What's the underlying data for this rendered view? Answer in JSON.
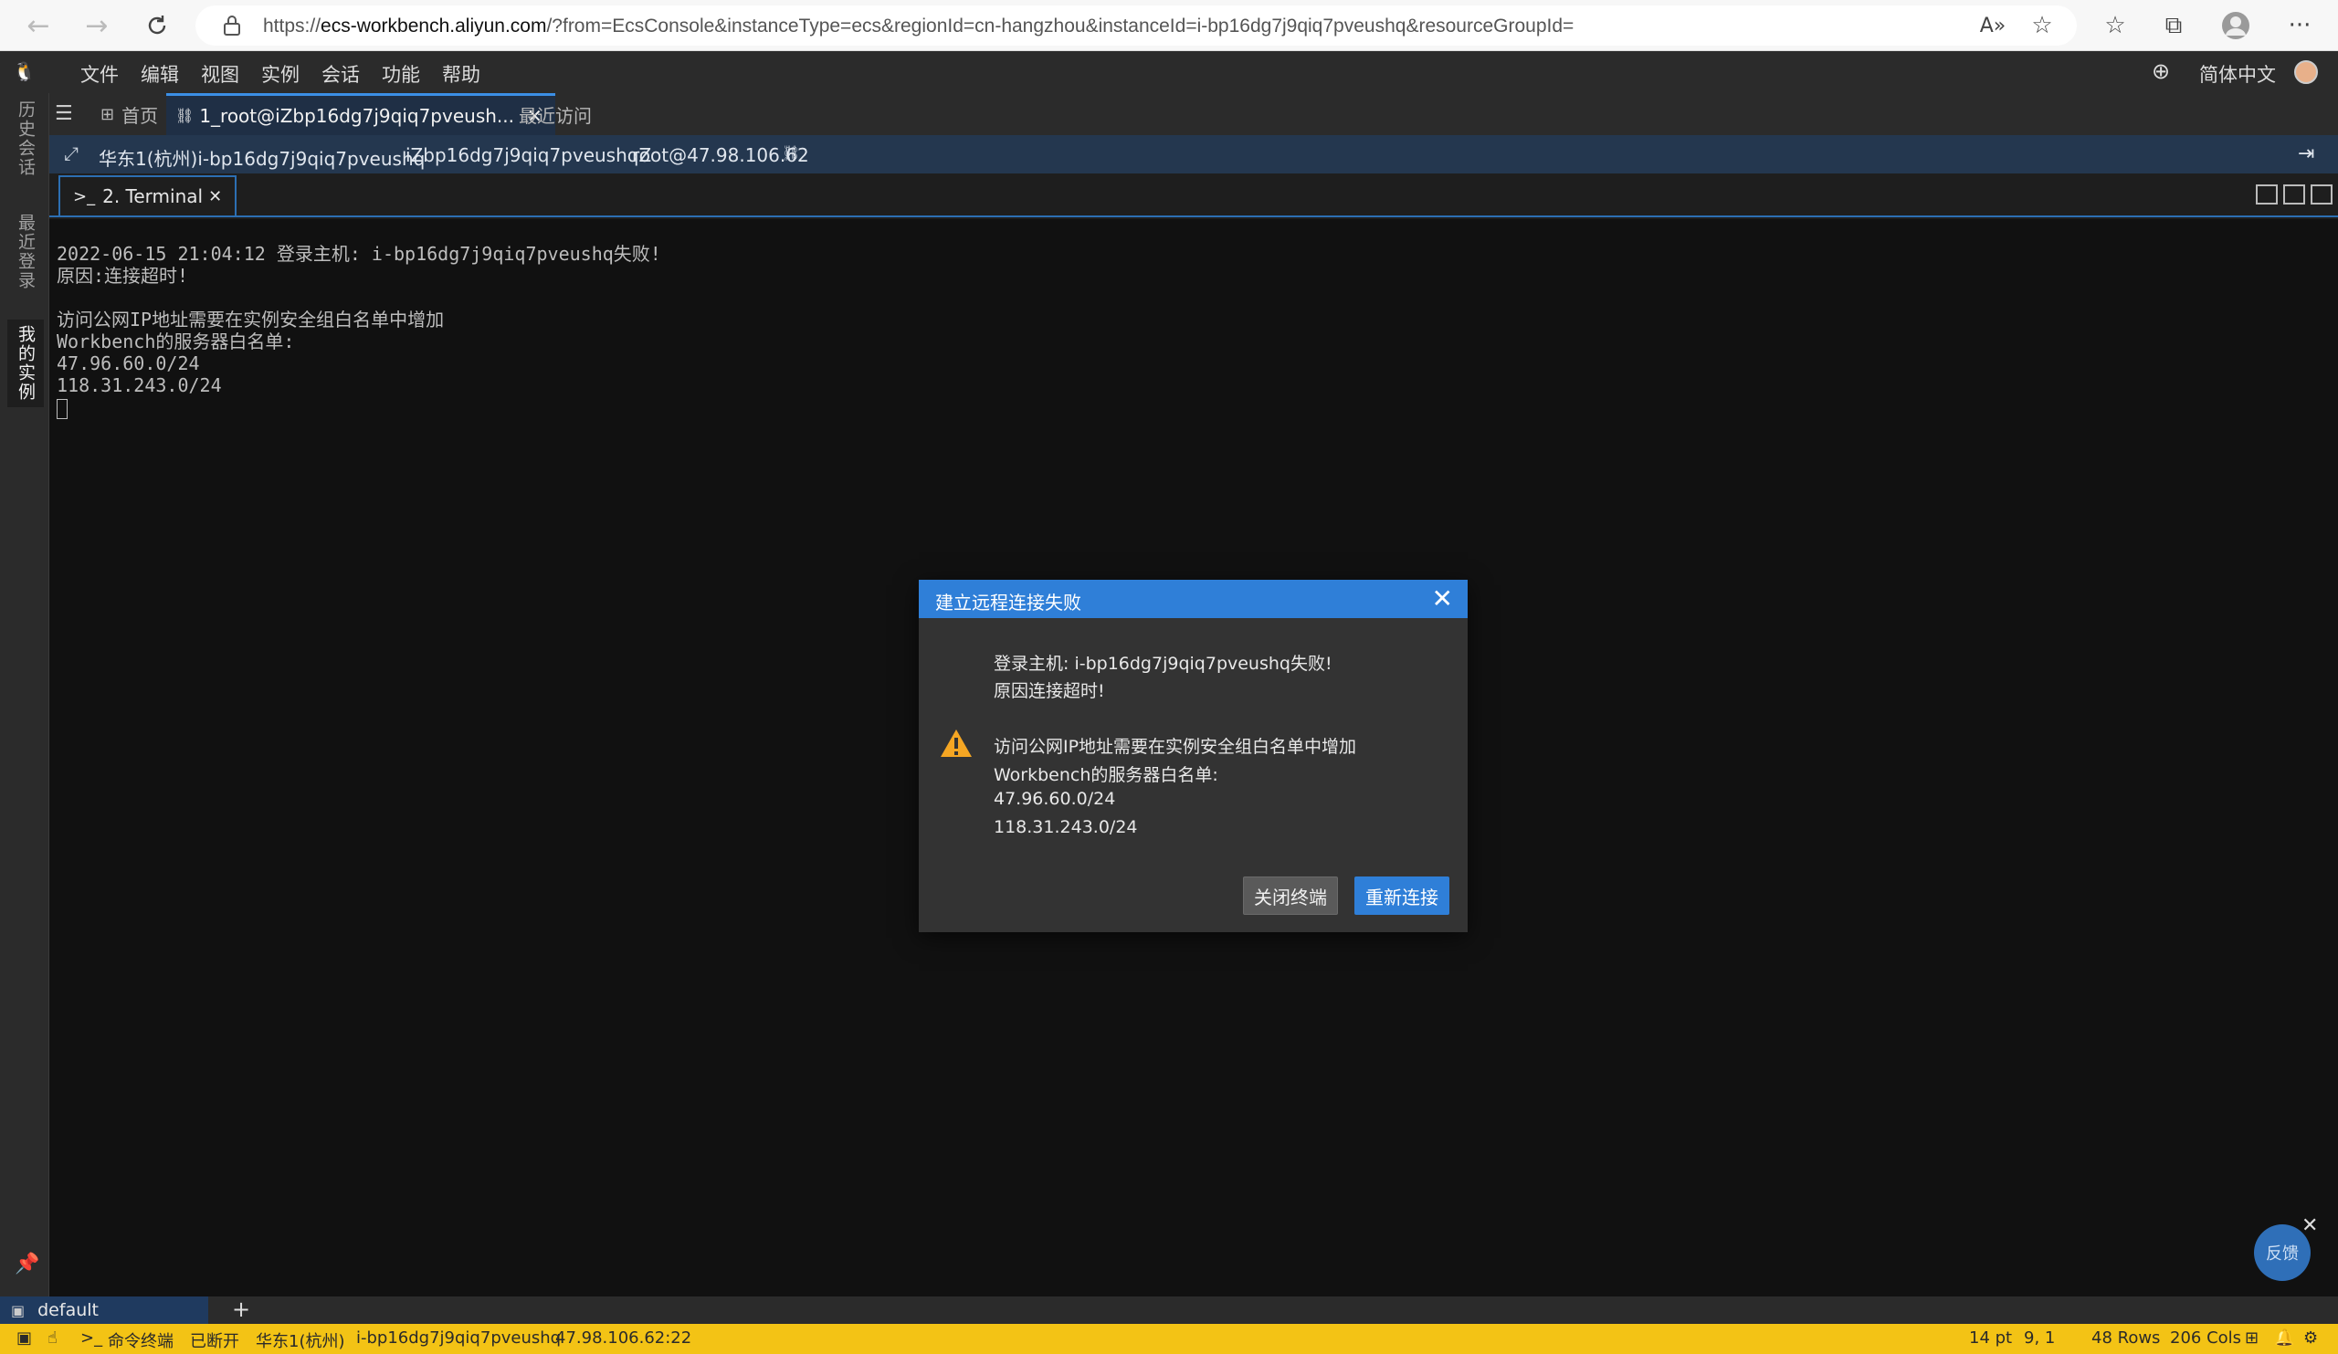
{
  "browser": {
    "url_prefix": "https://",
    "url_host": "ecs-workbench.aliyun.com",
    "url_rest": "/?from=EcsConsole&instanceType=ecs&regionId=cn-hangzhou&instanceId=i-bp16dg7j9qiq7pveushq&resourceGroupId="
  },
  "menu": {
    "items": [
      "文件",
      "编辑",
      "视图",
      "实例",
      "会话",
      "功能",
      "帮助"
    ],
    "language": "简体中文"
  },
  "rail": {
    "items": [
      "历史会话",
      "最近登录",
      "我的实例"
    ]
  },
  "tabs": {
    "home": "首页",
    "session": "1_root@iZbp16dg7j9qiq7pveush...",
    "recent": "最近访问"
  },
  "info_bar": {
    "region_instance": "华东1(杭州)i-bp16dg7j9qiq7pveushq",
    "hostname": "iZbp16dg7j9qiq7pveushqZ",
    "login": "root@47.98.106.62"
  },
  "terminal_tab": {
    "label": "2. Terminal"
  },
  "terminal": {
    "lines": [
      "2022-06-15 21:04:12 登录主机: i-bp16dg7j9qiq7pveushq失败!",
      "原因:连接超时!",
      "",
      "访问公网IP地址需要在实例安全组白名单中增加",
      "Workbench的服务器白名单:",
      "47.96.60.0/24",
      "118.31.243.0/24"
    ]
  },
  "dialog": {
    "title": "建立远程连接失败",
    "line1": "登录主机: i-bp16dg7j9qiq7pveushq失败!",
    "line2": "原因连接超时!",
    "line3": "访问公网IP地址需要在实例安全组白名单中增加",
    "line4": "Workbench的服务器白名单:",
    "line5": "47.96.60.0/24",
    "line6": "118.31.243.0/24",
    "btn_close": "关闭终端",
    "btn_reconnect": "重新连接"
  },
  "feedback": "反馈",
  "session_bar": {
    "tab": "default",
    "add": "+"
  },
  "status_bar": {
    "terminal": "命令终端",
    "state": "已断开",
    "region": "华东1(杭州)",
    "instance": "i-bp16dg7j9qiq7pveushq",
    "address": "47.98.106.62:22",
    "font_size": "14 pt",
    "cursor_pos": "9, 1",
    "rows": "48 Rows",
    "cols": "206 Cols"
  },
  "colors": {
    "accent": "#2f7fd8",
    "status_bar": "#f3c315",
    "warning": "#f5a623"
  }
}
